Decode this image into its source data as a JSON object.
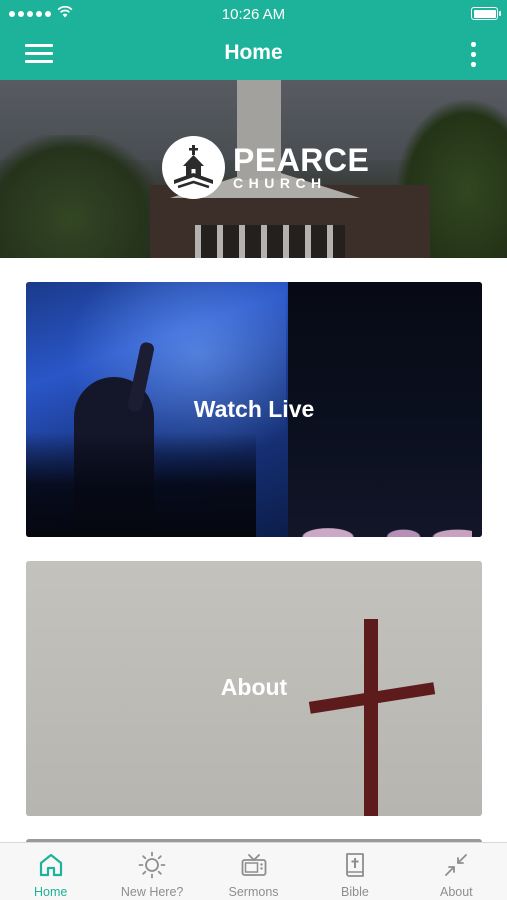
{
  "status_bar": {
    "time": "10:26 AM",
    "signal_bars": 5
  },
  "nav": {
    "title": "Home",
    "menu_icon": "hamburger-menu-icon",
    "more_icon": "vertical-more-icon"
  },
  "hero": {
    "logo_main": "PEARCE",
    "logo_sub": "CHURCH"
  },
  "cards": [
    {
      "label": "Watch Live"
    },
    {
      "label": "About"
    }
  ],
  "tabbar": {
    "active_color": "#1cb39a",
    "inactive_color": "#8e8e8e",
    "tabs": [
      {
        "label": "Home",
        "icon": "home-icon",
        "active": true
      },
      {
        "label": "New Here?",
        "icon": "sun-icon",
        "active": false
      },
      {
        "label": "Sermons",
        "icon": "tv-icon",
        "active": false
      },
      {
        "label": "Bible",
        "icon": "bible-icon",
        "active": false
      },
      {
        "label": "About",
        "icon": "collapse-arrows-icon",
        "active": false
      }
    ]
  },
  "colors": {
    "brand": "#1cb39a",
    "background": "#ffffff"
  }
}
